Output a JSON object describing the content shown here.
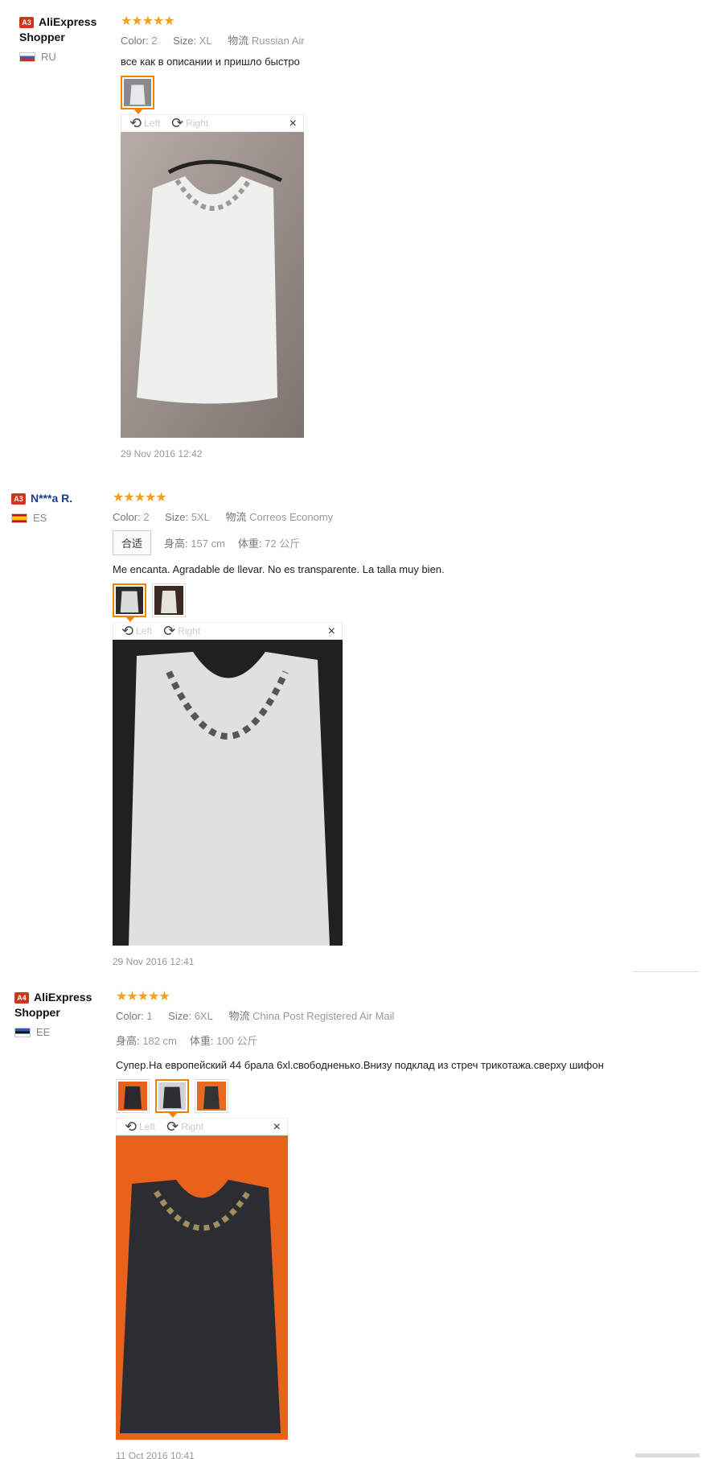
{
  "reviews": [
    {
      "level": "A3",
      "name": "AliExpress Shopper",
      "country": "RU",
      "stars": "★★★★★",
      "attrs": [
        {
          "k": "Color:",
          "v": "2"
        },
        {
          "k": "Size:",
          "v": "XL"
        },
        {
          "k": "物流",
          "v": "Russian Air"
        }
      ],
      "text": "все как в описании и пришло быстро",
      "viewer": {
        "left": "Left",
        "right": "Right",
        "close": "×"
      },
      "date": "29 Nov 2016 12:42"
    },
    {
      "level": "A3",
      "name": "N***a R.",
      "country": "ES",
      "stars": "★★★★★",
      "attrs": [
        {
          "k": "Color:",
          "v": "2"
        },
        {
          "k": "Size:",
          "v": "5XL"
        },
        {
          "k": "物流",
          "v": "Correos Economy"
        }
      ],
      "fit": {
        "label": "合适",
        "height_k": "身高:",
        "height_v": "157 cm",
        "weight_k": "体重:",
        "weight_v": "72 公斤"
      },
      "text": "Me encanta. Agradable de llevar. No es transparente. La talla muy bien.",
      "viewer": {
        "left": "Left",
        "right": "Right",
        "close": "×"
      },
      "date": "29 Nov 2016 12:41"
    },
    {
      "level": "A4",
      "name": "AliExpress Shopper",
      "country": "EE",
      "stars": "★★★★★",
      "attrs": [
        {
          "k": "Color:",
          "v": "1"
        },
        {
          "k": "Size:",
          "v": "6XL"
        },
        {
          "k": "物流",
          "v": "China Post Registered Air Mail"
        }
      ],
      "fit": {
        "height_k": "身高:",
        "height_v": "182 cm",
        "weight_k": "体重:",
        "weight_v": "100 公斤"
      },
      "text": "Супер.На европейский 44 брала 6xl.свободненько.Внизу подклад из стреч трикотажа.сверху шифон",
      "viewer": {
        "left": "Left",
        "right": "Right",
        "close": "×"
      },
      "date": "11 Oct 2016 10:41"
    }
  ],
  "icons": {
    "rotate_left": "rotate-left-icon",
    "rotate_right": "rotate-right-icon",
    "close": "close-icon",
    "star": "star-icon"
  }
}
